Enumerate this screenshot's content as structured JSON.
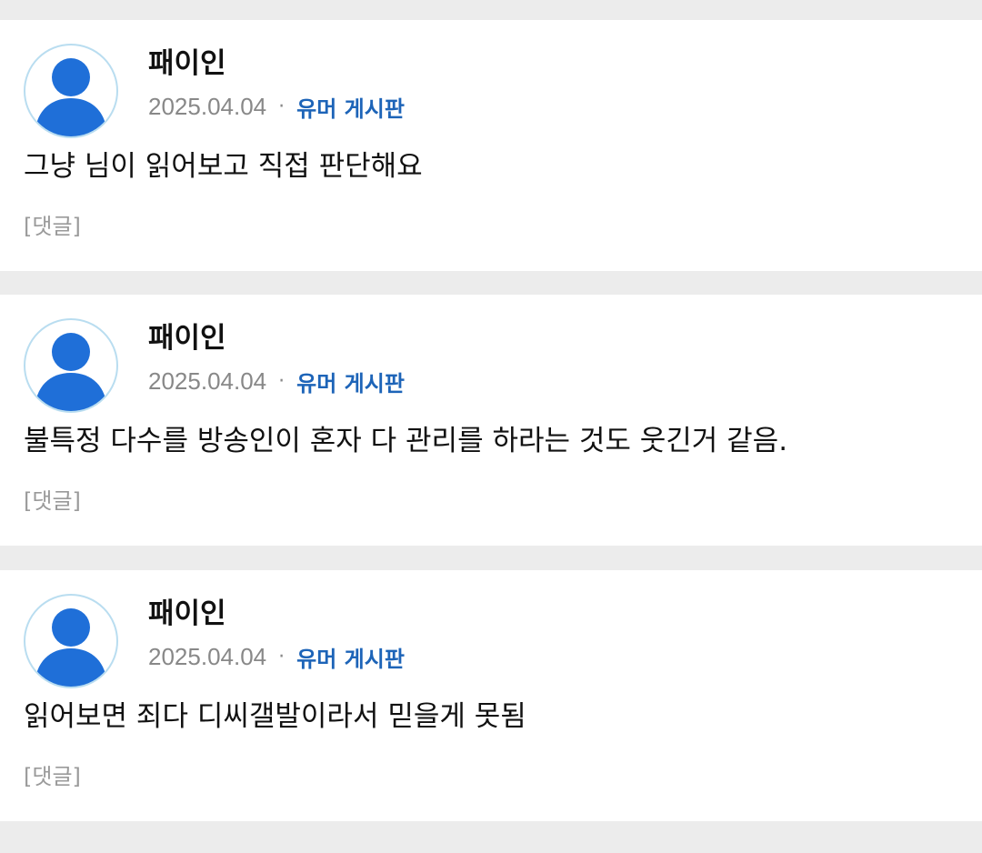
{
  "comments": [
    {
      "author": "패이인",
      "date": "2025.04.04",
      "separator": "·",
      "board": "유머 게시판",
      "text": "그냥 님이 읽어보고 직접 판단해요",
      "reply_label": "[댓글]"
    },
    {
      "author": "패이인",
      "date": "2025.04.04",
      "separator": "·",
      "board": "유머 게시판",
      "text": "불특정 다수를 방송인이 혼자 다 관리를 하라는 것도 웃긴거 같음.",
      "reply_label": "[댓글]"
    },
    {
      "author": "패이인",
      "date": "2025.04.04",
      "separator": "·",
      "board": "유머 게시판",
      "text": "읽어보면 죄다 디씨갤발이라서 믿을게 못됨",
      "reply_label": "[댓글]"
    }
  ],
  "colors": {
    "page_background": "#ececec",
    "card_background": "#ffffff",
    "avatar_fill": "#1f6fd8",
    "avatar_ring": "#b9ddf0",
    "board_link": "#1d64b8",
    "muted_text": "#888888"
  },
  "icons": {
    "avatar": "user-silhouette-icon"
  }
}
